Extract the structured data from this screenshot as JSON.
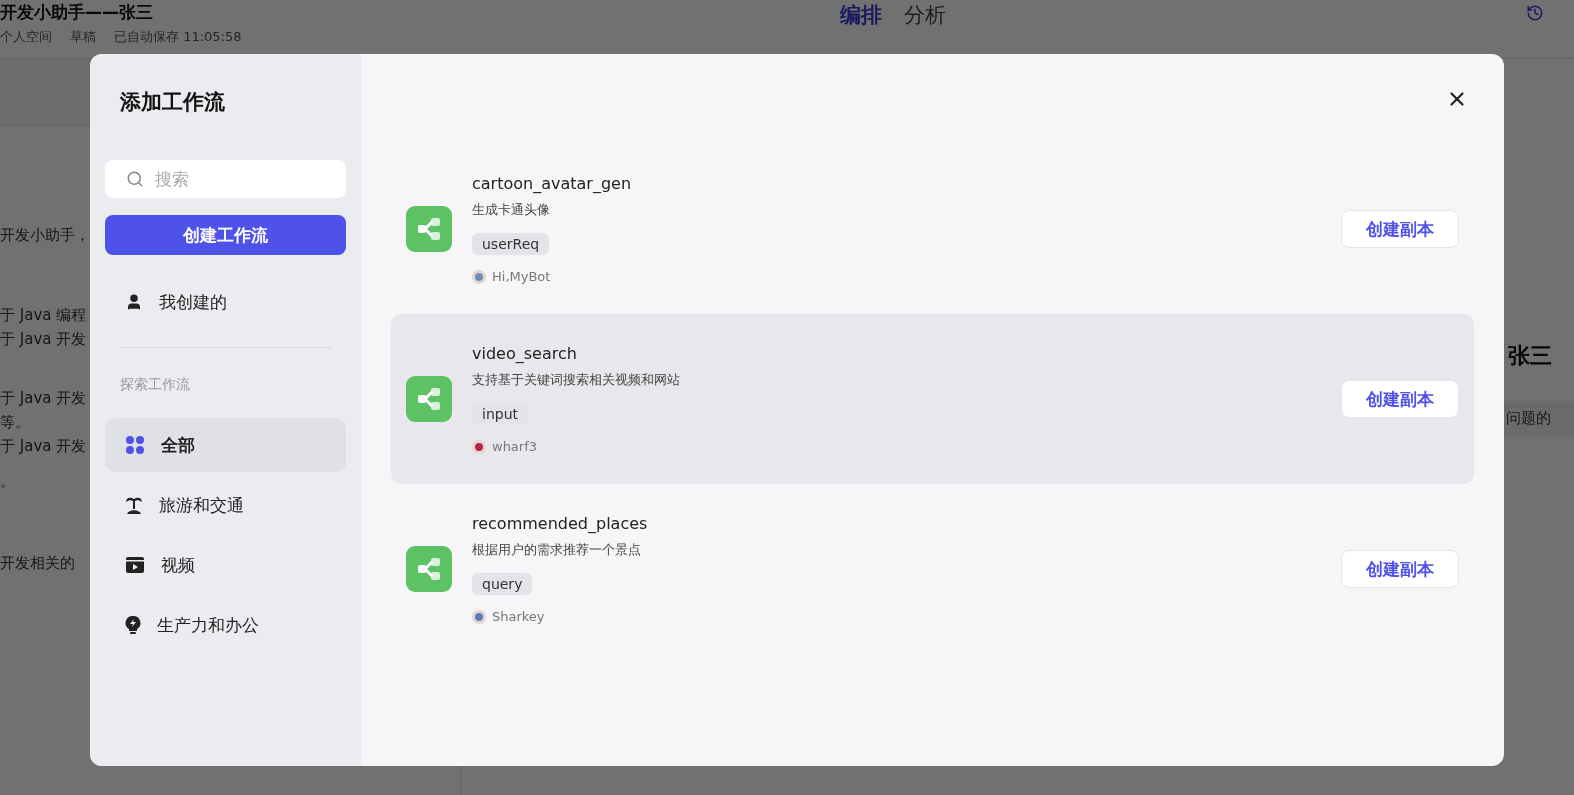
{
  "page": {
    "title": "开发小助手——张三",
    "space": "个人空间",
    "status": "草稿",
    "autosave": "已自动保存 11:05:58",
    "tabs": [
      {
        "label": "编排",
        "selected": true
      },
      {
        "label": "分析",
        "selected": false
      }
    ],
    "left_text": [
      "开发小助手，",
      "于 Java 编程",
      "于 Java 开发",
      "于 Java 开发",
      "等。",
      "于 Java 开发",
      "。",
      "开发相关的"
    ],
    "right_heading": "张三",
    "right_text": "问题的"
  },
  "dialog": {
    "title": "添加工作流",
    "search": {
      "placeholder": "搜索"
    },
    "create_button": "创建工作流",
    "my_item": "我创建的",
    "section": "探索工作流",
    "categories": [
      {
        "label": "全部",
        "kind": "all",
        "selected": true
      },
      {
        "label": "旅游和交通",
        "kind": "travel",
        "selected": false
      },
      {
        "label": "视频",
        "kind": "video",
        "selected": false
      },
      {
        "label": "生产力和办公",
        "kind": "productivity",
        "selected": false
      }
    ],
    "workflows": [
      {
        "name": "cartoon_avatar_gen",
        "description": "生成卡通头像",
        "tag": "userReq",
        "author": "Hi,MyBot",
        "button": "创建副本",
        "highlighted": false
      },
      {
        "name": "video_search",
        "description": "支持基于关键词搜索相关视频和网站",
        "tag": "input",
        "author": "wharf3",
        "button": "创建副本",
        "highlighted": true
      },
      {
        "name": "recommended_places",
        "description": "根据用户的需求推荐一个景点",
        "tag": "query",
        "author": "Sharkey",
        "button": "创建副本",
        "highlighted": false
      }
    ]
  }
}
